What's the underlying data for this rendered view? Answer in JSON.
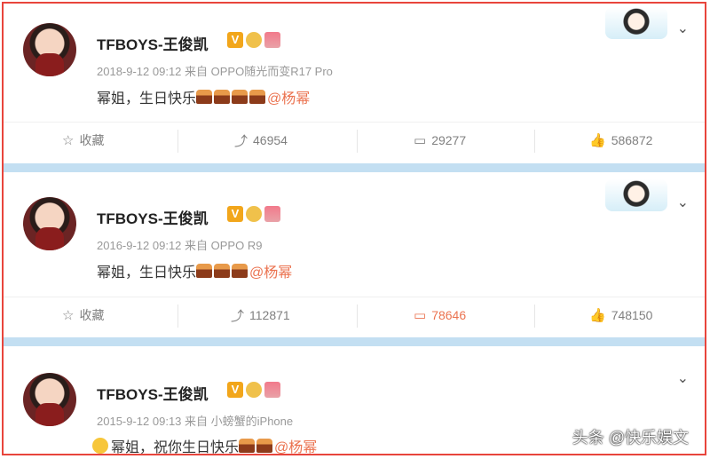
{
  "posts": [
    {
      "author": "TFBOYS-王俊凯",
      "meta": "2018-9-12 09:12 来自 OPPO随光而变R17 Pro",
      "text": "幂姐，生日快乐",
      "cakes": 4,
      "mention": "@杨幂",
      "actions": {
        "favorite": "收藏",
        "repost": "46954",
        "comment": "29277",
        "like": "586872"
      },
      "has_deco": true,
      "comment_highlight": false
    },
    {
      "author": "TFBOYS-王俊凯",
      "meta": "2016-9-12 09:12 来自 OPPO R9",
      "text": "幂姐，生日快乐",
      "cakes": 3,
      "mention": "@杨幂",
      "actions": {
        "favorite": "收藏",
        "repost": "112871",
        "comment": "78646",
        "like": "748150"
      },
      "has_deco": true,
      "comment_highlight": true
    },
    {
      "author": "TFBOYS-王俊凯",
      "meta": "2015-9-12 09:13 来自 小螃蟹的iPhone",
      "text": "幂姐，祝你生日快乐",
      "cakes": 2,
      "mention": "@杨幂",
      "has_deco": false
    }
  ],
  "icons": {
    "star": "☆",
    "repost": "⤴",
    "comment": "▭",
    "like": "👍",
    "chevron": "⌄",
    "v_badge": "V"
  },
  "watermark": "头条 @快乐娱文",
  "colors": {
    "accent": "#eb7350",
    "separator": "#c3dff2",
    "frame": "#e8453c"
  }
}
